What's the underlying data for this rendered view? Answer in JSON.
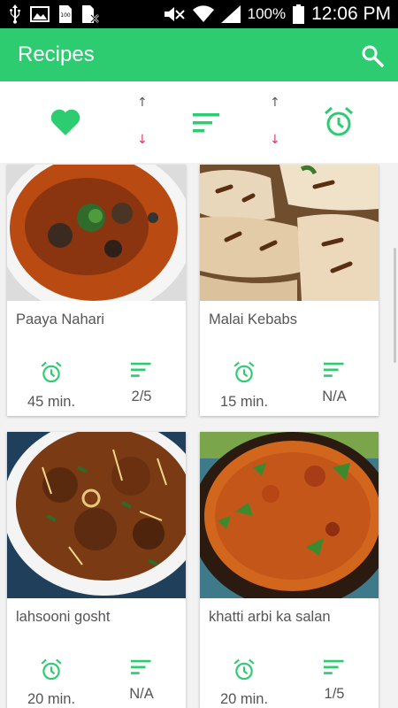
{
  "status_bar": {
    "battery_percent": "100%",
    "time": "12:06 PM",
    "sim_label": "100",
    "icons": [
      "usb-icon",
      "image-icon",
      "sim-card-icon",
      "no-sim-icon",
      "mute-icon",
      "wifi-icon",
      "signal-icon",
      "battery-icon"
    ]
  },
  "app_bar": {
    "title": "Recipes",
    "color": "#2ecc71",
    "search_icon": "search-icon"
  },
  "filter_bar": {
    "items": [
      "favorite-heart-icon",
      "sort-up-arrow",
      "sort-down-arrow",
      "difficulty-filter-icon",
      "sort-up-arrow",
      "sort-down-arrow",
      "time-alarm-icon"
    ],
    "accent": "#2ecc71",
    "down_arrow_color": "#e5335f"
  },
  "recipes": [
    {
      "name": "Paaya Nahari",
      "time": "45 min.",
      "difficulty": "2/5"
    },
    {
      "name": "Malai Kebabs",
      "time": "15 min.",
      "difficulty": "N/A"
    },
    {
      "name": "lahsooni gosht",
      "time": "20 min.",
      "difficulty": "N/A"
    },
    {
      "name": "khatti arbi ka salan",
      "time": "20 min.",
      "difficulty": "1/5"
    }
  ]
}
